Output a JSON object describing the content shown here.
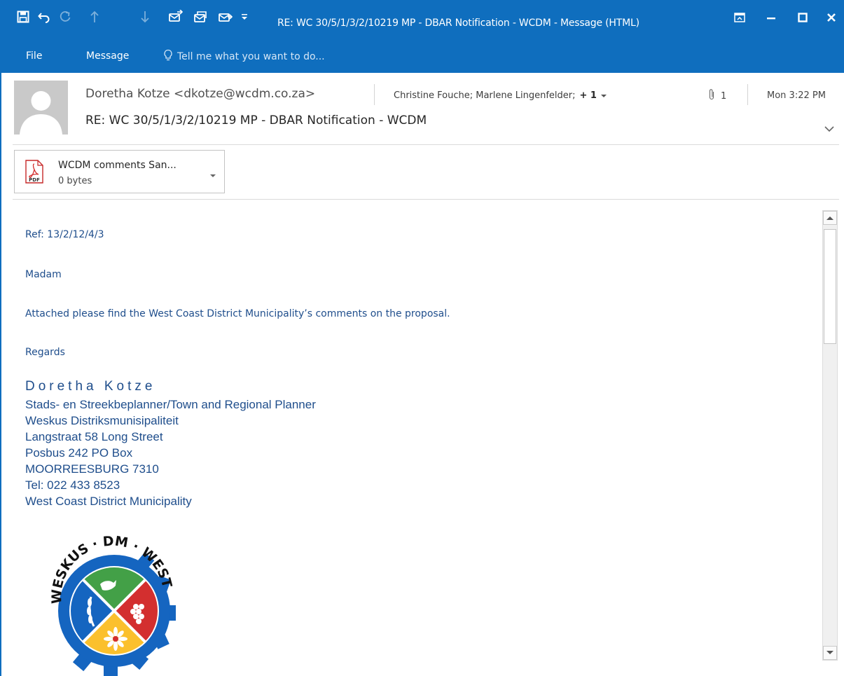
{
  "window": {
    "title": "RE: WC 30/5/1/3/2/10219 MP - DBAR Notification - WCDM - Message (HTML)"
  },
  "quick_access": {
    "icons": [
      "save-icon",
      "undo-icon",
      "redo-icon",
      "previous-item-icon",
      "next-item-icon",
      "reply-icon",
      "reply-all-icon",
      "forward-icon",
      "customize-dropdown-icon"
    ]
  },
  "ribbon": {
    "tabs": [
      "File",
      "Message"
    ],
    "tell_me_placeholder": "Tell me what you want to do..."
  },
  "header": {
    "sender": "Doretha Kotze <dkotze@wcdm.co.za>",
    "recipients": "Christine Fouche; Marlene Lingenfelder;",
    "more_recipients": "+ 1",
    "attachment_count": "1",
    "date": "Mon 3:22 PM",
    "subject": "RE: WC 30/5/1/3/2/10219 MP - DBAR Notification - WCDM"
  },
  "attachment": {
    "name": "WCDM comments San...",
    "size": "0 bytes",
    "icon_label": "PDF"
  },
  "body": {
    "ref": "Ref:  13/2/12/4/3",
    "salutation": "Madam",
    "paragraph": "Attached please find the West Coast District Municipality’s comments on the proposal.",
    "closing": "Regards"
  },
  "signature": {
    "name": "Doretha Kotze",
    "lines": [
      "Stads- en Streekbeplanner/Town and Regional Planner",
      "Weskus Distriksmunisipaliteit",
      "Langstraat 58 Long Street",
      "Posbus 242 PO Box",
      "MOORREESBURG 7310",
      "Tel:  022 433 8523",
      "West Coast District Municipality"
    ]
  },
  "logo": {
    "text": "WESKUS · DM · WEST COAST",
    "colors": {
      "blue": "#1565c0",
      "green": "#43a047",
      "red": "#d32f2f",
      "yellow": "#fbc02d"
    }
  },
  "colors": {
    "accent": "#0f6ebe",
    "body_text": "#1f4e8c"
  }
}
